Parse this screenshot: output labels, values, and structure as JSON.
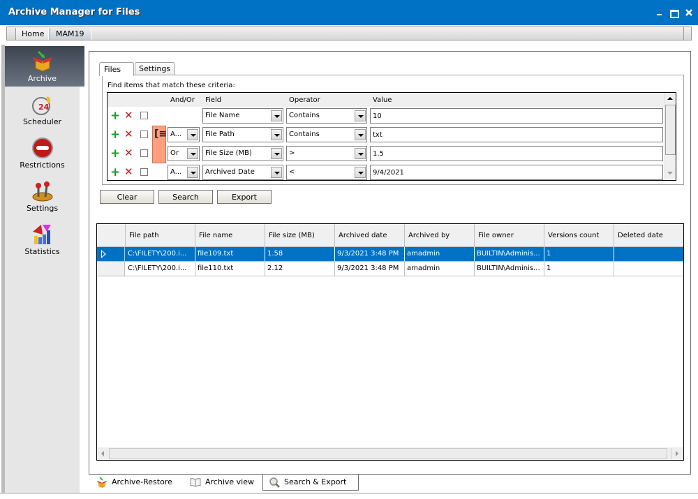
{
  "window": {
    "title": "Archive Manager for Files",
    "controls": [
      "minimize",
      "maximize",
      "close"
    ]
  },
  "breadcrumb": [
    "Home",
    "MAM19"
  ],
  "sidebar": {
    "items": [
      {
        "label": "Archive",
        "icon": "archive-box-icon",
        "active": true
      },
      {
        "label": "Scheduler",
        "icon": "scheduler-clock-icon",
        "active": false
      },
      {
        "label": "Restrictions",
        "icon": "no-entry-icon",
        "active": false
      },
      {
        "label": "Settings",
        "icon": "joystick-icon",
        "active": false
      },
      {
        "label": "Statistics",
        "icon": "statistics-chart-icon",
        "active": false
      }
    ]
  },
  "search": {
    "tabs": [
      {
        "label": "Files",
        "active": true
      },
      {
        "label": "Settings",
        "active": false
      }
    ],
    "criteria_label": "Find items that match these criteria:",
    "columns": {
      "andor": "And/Or",
      "field": "Field",
      "operator": "Operator",
      "value": "Value"
    },
    "rows": [
      {
        "andor": "",
        "field": "File Name",
        "operator": "Contains",
        "value": "10"
      },
      {
        "andor": "A...",
        "field": "File Path",
        "operator": "Contains",
        "value": "txt"
      },
      {
        "andor": "Or",
        "field": "File Size (MB)",
        "operator": ">",
        "value": "1.5"
      },
      {
        "andor": "A...",
        "field": "Archived Date",
        "operator": "<",
        "value": "9/4/2021"
      }
    ],
    "group_marker": "[≡",
    "buttons": {
      "clear": "Clear",
      "search": "Search",
      "export": "Export"
    }
  },
  "results": {
    "columns": [
      "File path",
      "File name",
      "File size (MB)",
      "Archived date",
      "Archived by",
      "File owner",
      "Versions count",
      "Deleted date"
    ],
    "rows": [
      {
        "selected": true,
        "cells": [
          "C:\\FILETY\\200.i...",
          "file109.txt",
          "1.58",
          "9/3/2021 3:48 PM",
          "amadmin",
          "BUILTIN\\Adminis...",
          "1",
          ""
        ]
      },
      {
        "selected": false,
        "cells": [
          "C:\\FILETY\\200.i...",
          "file110.txt",
          "2.12",
          "9/3/2021 3:48 PM",
          "amadmin",
          "BUILTIN\\Adminis...",
          "1",
          ""
        ]
      }
    ]
  },
  "bottom_tabs": [
    {
      "label": "Archive-Restore",
      "icon": "archive-box-icon",
      "active": false
    },
    {
      "label": "Archive view",
      "icon": "book-icon",
      "active": false
    },
    {
      "label": "Search & Export",
      "icon": "magnifier-icon",
      "active": true
    }
  ],
  "colors": {
    "titlebar": "#0072c6",
    "selection": "#0072c6",
    "group_marker": "#ff9f80",
    "add": "#1a9a2a",
    "remove": "#cc1a1a"
  }
}
